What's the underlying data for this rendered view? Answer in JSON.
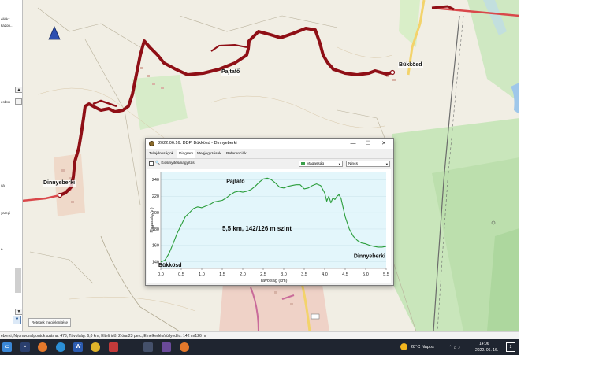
{
  "left_panel": {
    "items": [
      "ellékz...",
      "kazon...",
      "esbük",
      "ca",
      "yaregi",
      "e"
    ],
    "layers_button": "Rétegek megjelenítése"
  },
  "map": {
    "labels": {
      "bukkosd": "Bükkösd",
      "pajtafo": "Pajtafő",
      "dinnyeberki": "Dinnyeberki"
    }
  },
  "statusbar": {
    "text": "eberki, Nyomvonalpontok száma: 473, Távolság: 6,0 km, Eltelt idő: 2 óra 23 perc, Emelkedés/süllyedés: 142 m/126 m"
  },
  "dialog": {
    "title": "2022.06.16. DDP, Bükkösd - Dinnyeberki",
    "tabs": [
      "Tulajdonságok",
      "Diagram",
      "Megjegyzések",
      "Referenciák"
    ],
    "active_tab": "Diagram",
    "zoom_label": "Kicsinyítés/nagyítás",
    "select_left": "Magasság",
    "select_right": "Nincs",
    "window_buttons": {
      "minimize": "—",
      "maximize": "☐",
      "close": "✕"
    }
  },
  "taskbar": {
    "weather": "28°C  Napos",
    "time": "14:06",
    "date": "2022. 06. 16.",
    "notification_count": "2"
  },
  "chart_data": {
    "type": "area",
    "xlabel": "Távolság  (km)",
    "ylabel": "Magasság (m)",
    "xlim": [
      0.0,
      5.5
    ],
    "ylim": [
      132,
      250
    ],
    "xticks": [
      "0.0",
      "0.5",
      "1.0",
      "1.5",
      "2.0",
      "2.5",
      "3.0",
      "3.5",
      "4.0",
      "4.5",
      "5.0",
      "5.5"
    ],
    "yticks": [
      "140",
      "160",
      "180",
      "200",
      "220",
      "240"
    ],
    "annotation": "5,5 km, 142/126 m szint",
    "start_label": "Bükkösd",
    "end_label": "Dinnyeberki",
    "peak_label": "Pajtafő",
    "line_color": "#2a9d3a",
    "fill_color": "#e3f6fb",
    "x": [
      0.0,
      0.1,
      0.2,
      0.3,
      0.4,
      0.5,
      0.6,
      0.7,
      0.8,
      0.9,
      1.0,
      1.1,
      1.2,
      1.3,
      1.4,
      1.5,
      1.6,
      1.7,
      1.8,
      1.9,
      2.0,
      2.1,
      2.2,
      2.3,
      2.4,
      2.5,
      2.6,
      2.7,
      2.8,
      2.9,
      3.0,
      3.1,
      3.2,
      3.3,
      3.4,
      3.5,
      3.6,
      3.7,
      3.8,
      3.9,
      4.0,
      4.05,
      4.1,
      4.15,
      4.2,
      4.25,
      4.3,
      4.35,
      4.4,
      4.5,
      4.6,
      4.7,
      4.8,
      4.9,
      5.0,
      5.1,
      5.2,
      5.3,
      5.4,
      5.5
    ],
    "y": [
      140,
      142,
      150,
      162,
      175,
      185,
      195,
      200,
      205,
      207,
      206,
      208,
      210,
      213,
      214,
      215,
      218,
      222,
      225,
      226,
      225,
      226,
      228,
      232,
      237,
      241,
      242,
      240,
      236,
      231,
      230,
      232,
      233,
      234,
      234,
      229,
      230,
      233,
      235,
      233,
      224,
      214,
      220,
      212,
      218,
      216,
      220,
      222,
      217,
      195,
      180,
      171,
      166,
      163,
      162,
      160,
      159,
      158,
      158,
      159
    ]
  }
}
